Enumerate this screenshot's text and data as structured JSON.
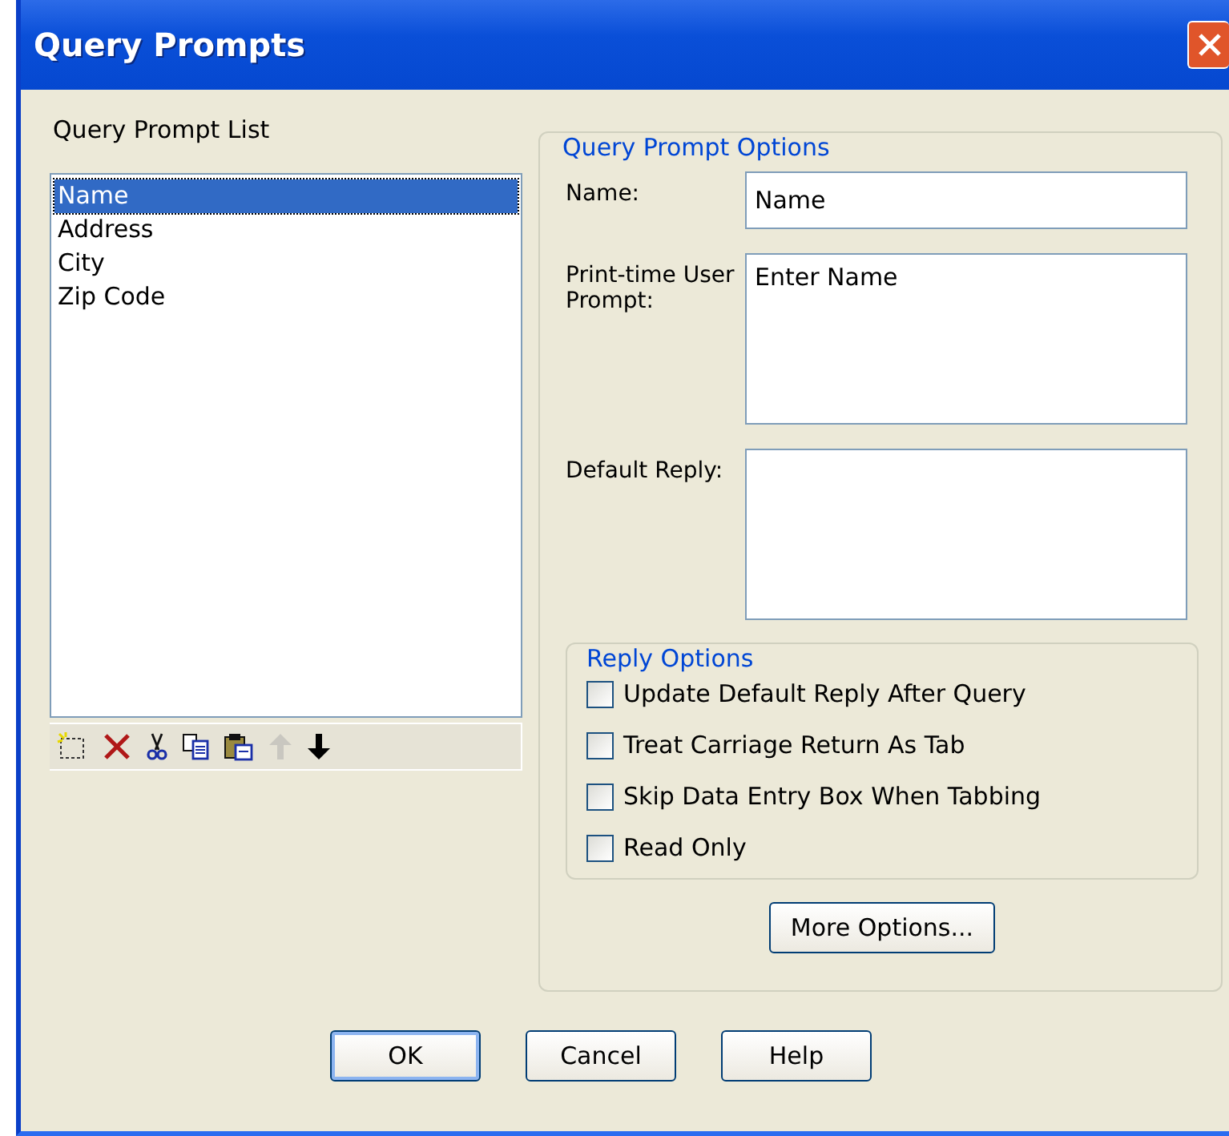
{
  "window": {
    "title": "Query Prompts"
  },
  "prompt_list": {
    "label": "Query Prompt List",
    "items": [
      {
        "label": "Name",
        "selected": true
      },
      {
        "label": "Address",
        "selected": false
      },
      {
        "label": "City",
        "selected": false
      },
      {
        "label": "Zip Code",
        "selected": false
      }
    ],
    "toolbar": [
      {
        "kind": "new",
        "disabled": false
      },
      {
        "kind": "delete",
        "disabled": false
      },
      {
        "kind": "cut",
        "disabled": false
      },
      {
        "kind": "copy",
        "disabled": false
      },
      {
        "kind": "paste",
        "disabled": false
      },
      {
        "kind": "up",
        "disabled": true
      },
      {
        "kind": "down",
        "disabled": false
      }
    ]
  },
  "options": {
    "title": "Query Prompt Options",
    "fields": [
      {
        "label": "Name:",
        "value": "Name",
        "kind": "line"
      },
      {
        "label": "Print-time User Prompt:",
        "value": "Enter Name",
        "kind": "box"
      },
      {
        "label": "Default Reply:",
        "kind": "box"
      }
    ],
    "reply_options": {
      "title": "Reply Options",
      "checkboxes": [
        {
          "label": "Update Default Reply After Query",
          "checked": false
        },
        {
          "label": "Treat Carriage Return As Tab",
          "checked": false
        },
        {
          "label": "Skip Data Entry Box When Tabbing",
          "checked": false
        },
        {
          "label": "Read Only",
          "checked": false
        }
      ]
    },
    "more_button": "More Options..."
  },
  "buttons": [
    {
      "label": "OK",
      "default": true
    },
    {
      "label": "Cancel",
      "default": false
    },
    {
      "label": "Help",
      "default": false
    }
  ]
}
